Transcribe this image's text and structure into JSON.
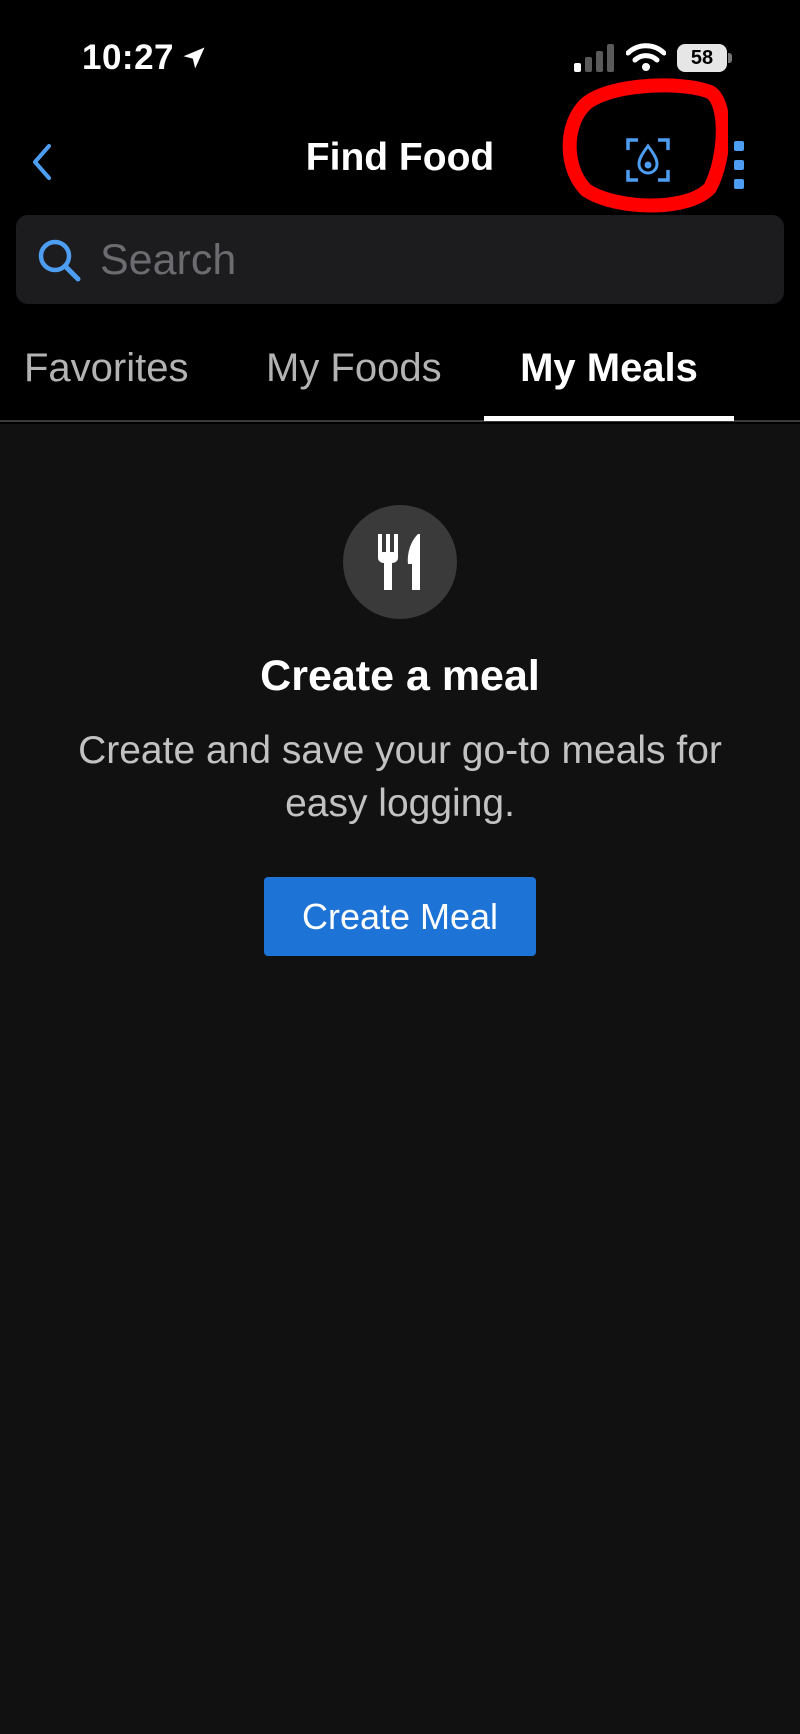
{
  "status_bar": {
    "time": "10:27",
    "battery": "58",
    "icons": [
      "location-arrow-icon",
      "cellular-signal-icon",
      "wifi-icon",
      "battery-icon"
    ]
  },
  "nav": {
    "title": "Find Food",
    "back_icon": "chevron-left-icon",
    "scan_icon": "meal-scan-icon",
    "more_icon": "more-vertical-icon"
  },
  "search": {
    "placeholder": "Search",
    "value": ""
  },
  "tabs": [
    {
      "label": "Favorites",
      "active": false
    },
    {
      "label": "My Foods",
      "active": false
    },
    {
      "label": "My Meals",
      "active": true
    }
  ],
  "empty_state": {
    "icon": "fork-knife-icon",
    "title": "Create a meal",
    "description": "Create and save your go-to meals for easy logging.",
    "button_label": "Create Meal"
  },
  "colors": {
    "accent": "#4d9ef2",
    "button": "#1e74d6",
    "annotation": "#ff0000",
    "background": "#111111"
  }
}
